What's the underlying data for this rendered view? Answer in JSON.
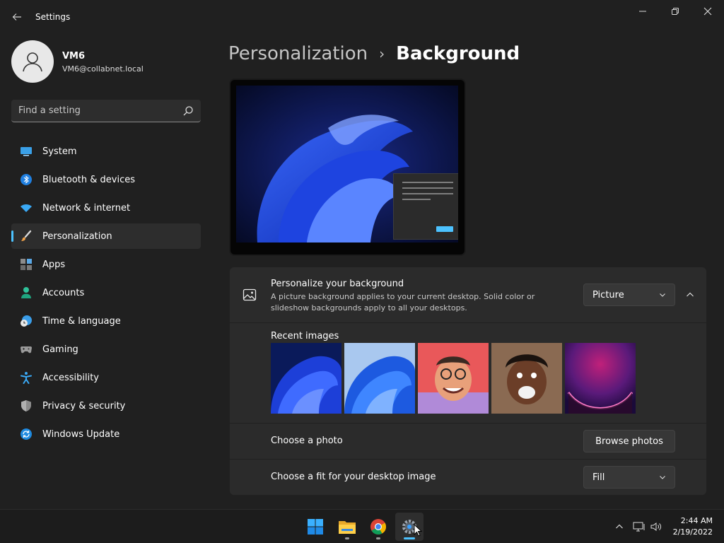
{
  "window": {
    "title": "Settings",
    "back_icon": "back-arrow-icon",
    "minimize_icon": "minimize-icon",
    "restore_icon": "restore-icon",
    "close_icon": "close-icon"
  },
  "user": {
    "name": "VM6",
    "email": "VM6@collabnet.local"
  },
  "search": {
    "placeholder": "Find a setting"
  },
  "sidebar": {
    "items": [
      {
        "label": "System",
        "icon": "system-icon",
        "selected": false
      },
      {
        "label": "Bluetooth & devices",
        "icon": "bluetooth-icon",
        "selected": false
      },
      {
        "label": "Network & internet",
        "icon": "network-icon",
        "selected": false
      },
      {
        "label": "Personalization",
        "icon": "brush-icon",
        "selected": true
      },
      {
        "label": "Apps",
        "icon": "apps-icon",
        "selected": false
      },
      {
        "label": "Accounts",
        "icon": "accounts-icon",
        "selected": false
      },
      {
        "label": "Time & language",
        "icon": "time-language-icon",
        "selected": false
      },
      {
        "label": "Gaming",
        "icon": "gaming-icon",
        "selected": false
      },
      {
        "label": "Accessibility",
        "icon": "accessibility-icon",
        "selected": false
      },
      {
        "label": "Privacy & security",
        "icon": "shield-icon",
        "selected": false
      },
      {
        "label": "Windows Update",
        "icon": "update-icon",
        "selected": false
      }
    ]
  },
  "breadcrumb": {
    "parent": "Personalization",
    "separator": "›",
    "current": "Background"
  },
  "background": {
    "title": "Personalize your background",
    "description": "A picture background applies to your current desktop. Solid color or slideshow backgrounds apply to all your desktops.",
    "type_value": "Picture",
    "recent_label": "Recent images",
    "recent_images": [
      "bloom-dark-wallpaper",
      "bloom-light-wallpaper",
      "cartoon-character-wallpaper",
      "person-portrait-wallpaper",
      "glow-purple-wallpaper"
    ],
    "choose_photo_label": "Choose a photo",
    "browse_button": "Browse photos",
    "fit_label": "Choose a fit for your desktop image",
    "fit_value": "Fill"
  },
  "taskbar": {
    "apps": [
      "start-icon",
      "file-explorer-icon",
      "chrome-icon",
      "settings-icon"
    ],
    "tray": [
      "show-hidden-icons-icon",
      "network-icon",
      "volume-icon"
    ],
    "time": "2:44 AM",
    "date": "2/19/2022"
  },
  "colors": {
    "background": "#202020",
    "panel": "#2b2b2b",
    "accent": "#4cc2ff"
  }
}
